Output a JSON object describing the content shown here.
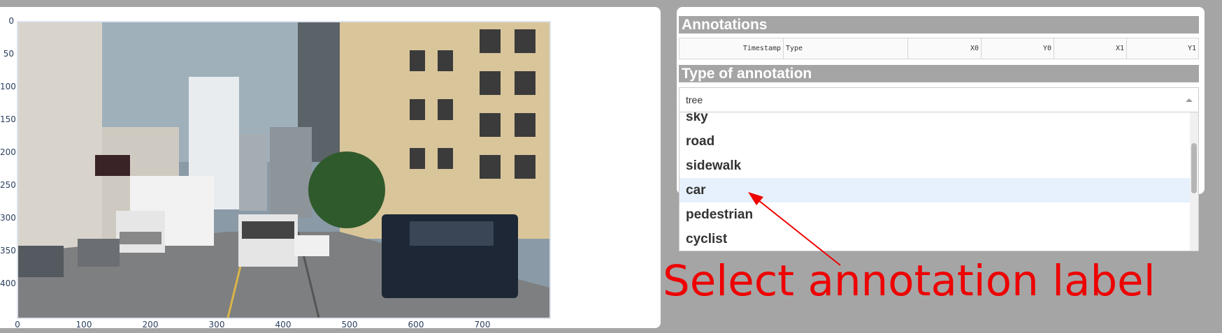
{
  "graph": {
    "image_alt": "street scene with truck, cars and buildings",
    "y_ticks": [
      "0",
      "50",
      "100",
      "150",
      "200",
      "250",
      "300",
      "350",
      "400"
    ],
    "x_ticks": [
      "0",
      "100",
      "200",
      "300",
      "400",
      "500",
      "600",
      "700"
    ]
  },
  "annotations": {
    "title": "Annotations",
    "columns": [
      "Timestamp",
      "Type",
      "X0",
      "Y0",
      "X1",
      "Y1"
    ]
  },
  "type_section": {
    "title": "Type of annotation",
    "selected_value": "tree",
    "options": [
      "sky",
      "road",
      "sidewalk",
      "car",
      "pedestrian",
      "cyclist"
    ],
    "highlighted_option": "car"
  },
  "callout": {
    "text": "Select annotation label",
    "color": "#ee0000"
  }
}
